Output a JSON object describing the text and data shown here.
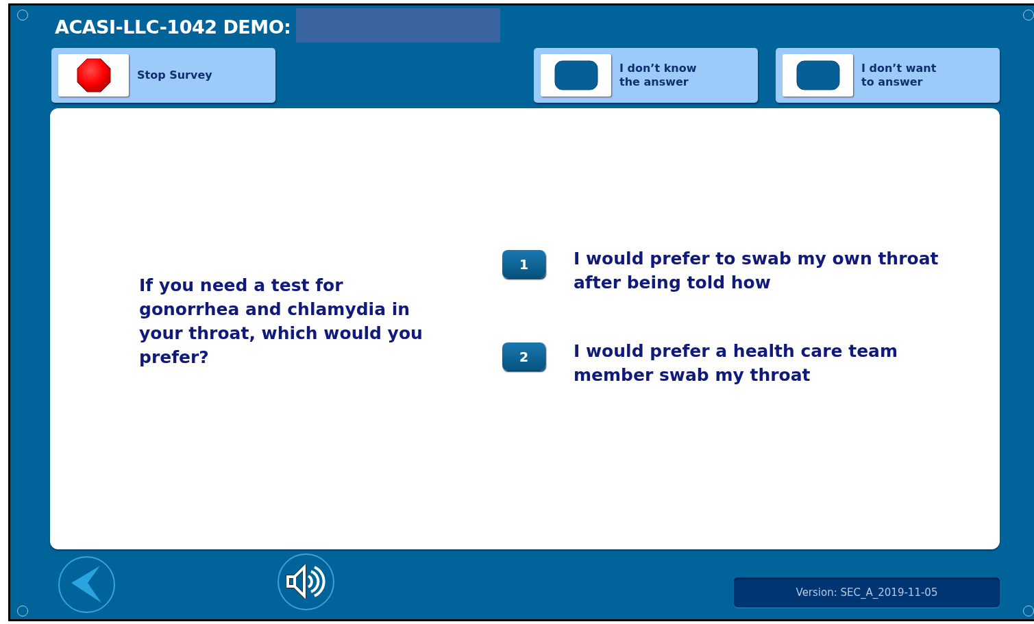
{
  "header": {
    "title": "ACASI-LLC-1042 DEMO:"
  },
  "top_buttons": [
    {
      "kind": "stop",
      "label": "Stop Survey"
    },
    {
      "kind": "blank",
      "label": "I don’t know\nthe answer"
    },
    {
      "kind": "blank",
      "label": "I don’t want\nto answer"
    }
  ],
  "question": "If you need a test for gonorrhea and chlamydia in your throat, which would you prefer?",
  "options": [
    {
      "number": "1",
      "text": "I would prefer to swab my own throat after being told how",
      "selected": false
    },
    {
      "number": "2",
      "text": "I would prefer a health care team member swab my throat",
      "selected": false
    }
  ],
  "version": "Version: SEC_A_2019-11-05"
}
